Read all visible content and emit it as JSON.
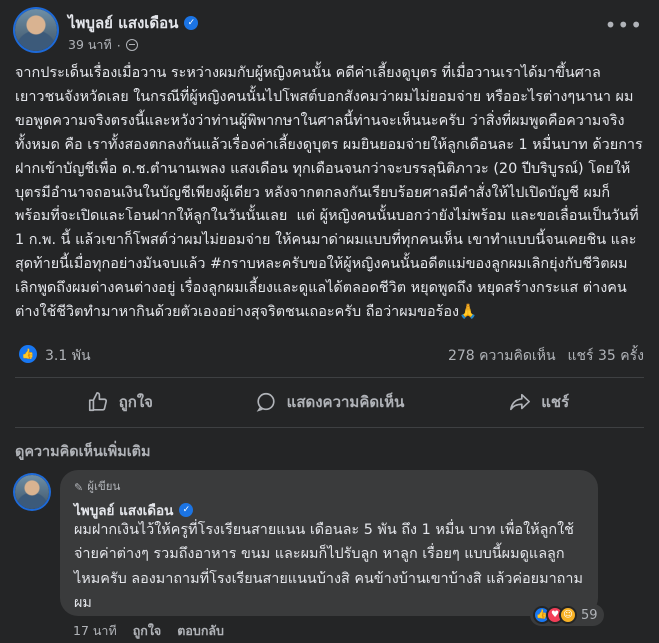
{
  "post": {
    "author": "ไพบูลย์ แสงเดือน",
    "time": "39 นาที",
    "text": "จากประเด็นเรื่องเมื่อวาน ระหว่างผมกับผู้หญิงคนนั้น คดีค่าเลี้ยงดูบุตร ที่เมื่อวานเราได้มาขึ้นศาลเยาวชนจังหวัดเลย ในกรณีที่ผู้หญิงคนนั้นไปโพสต์บอกสังคมว่าผมไม่ยอมจ่าย หรืออะไรต่างๆนานา ผมขอพูดความจริงตรงนี้และหวังว่าท่านผู้พิพากษาในศาลนี้ท่านจะเห็นนะครับ ว่าสิ่งที่ผมพูดคือความจริงทั้งหมด คือ เราทั้งสองตกลงกันแล้วเรื่องค่าเลี้ยงดูบุตร ผมยินยอมจ่ายให้ลูกเดือนละ 1 หมื่นบาท ด้วยการฝากเข้าบัญชีเพื่อ ด.ช.ตำนานเพลง แสงเดือน ทุกเดือนจนกว่าจะบรรลุนิติภาวะ (20 ปีบริบูรณ์) โดยให้บุตรมีอำนาจถอนเงินในบัญชีเพียงผู้เดียว หลังจากตกลงกันเรียบร้อยศาลมีคำสั่งให้ไปเปิดบัญชี ผมก็พร้อมที่จะเปิดและโอนฝากให้ลูกในวันนั้นเลย  แต่ ผู้หญิงคนนั้นบอกว่ายังไม่พร้อม และขอเลื่อนเป็นวันที่ 1 ก.พ. นี้ แล้วเขาก็โพสต์ว่าผมไม่ยอมจ่าย ให้คนมาด่าผมแบบที่ทุกคนเห็น เขาทำแบบนี้จนเคยชิน และสุดท้ายนี้เมื่อทุกอย่างมันจบแล้ว #กราบหละครับขอให้ผู้หญิงคนนั้นอดีตแม่ของลูกผมเลิกยุ่งกับชีวิตผมเลิกพูดถึงผมต่างคนต่างอยู่ เรื่องลูกผมเลี้ยงและดูแลได้ตลอดชีวิต หยุดพูดถึง หยุดสร้างกระแส ต่างคนต่างใช้ชีวิตทำมาหากินด้วยตัวเองอย่างสุจริตชนเถอะครับ ถือว่าผมขอร้อง🙏",
    "likes": "3.1 พัน",
    "comments_count": "278 ความคิดเห็น",
    "shares_count": "แชร์ 35 ครั้ง"
  },
  "actions": {
    "like": "ถูกใจ",
    "comment": "แสดงความคิดเห็น",
    "share": "แชร์"
  },
  "comments_section": {
    "more_comments": "ดูความคิดเห็นเพิ่มเติม"
  },
  "comment": {
    "badge": "ผู้เขียน",
    "author": "ไพบูลย์ แสงเดือน",
    "text": "ผมฝากเงินไว้ให้ครูที่โรงเรียนสายแนน เดือนละ 5 พัน ถึง 1 หมื่น บาท เพื่อให้ลูกใช้จ่ายค่าต่างๆ รวมถึงอาหาร ขนม และผมก็ไปรับลูก หาลูก เรื่อยๆ แบบนี้ผมดูแลลูกไหมครับ ลองมาถามที่โรงเรียนสายแนนบ้างสิ คนข้างบ้านเขาบ้างสิ แล้วค่อยมาถามผม",
    "reactions_count": "59",
    "time": "17 นาที",
    "like_label": "ถูกใจ",
    "reply_label": "ตอบกลับ"
  },
  "colors": {
    "background": "#242526",
    "accent": "#1877f2",
    "text": "#e4e6eb",
    "muted": "#b0b3b8"
  }
}
